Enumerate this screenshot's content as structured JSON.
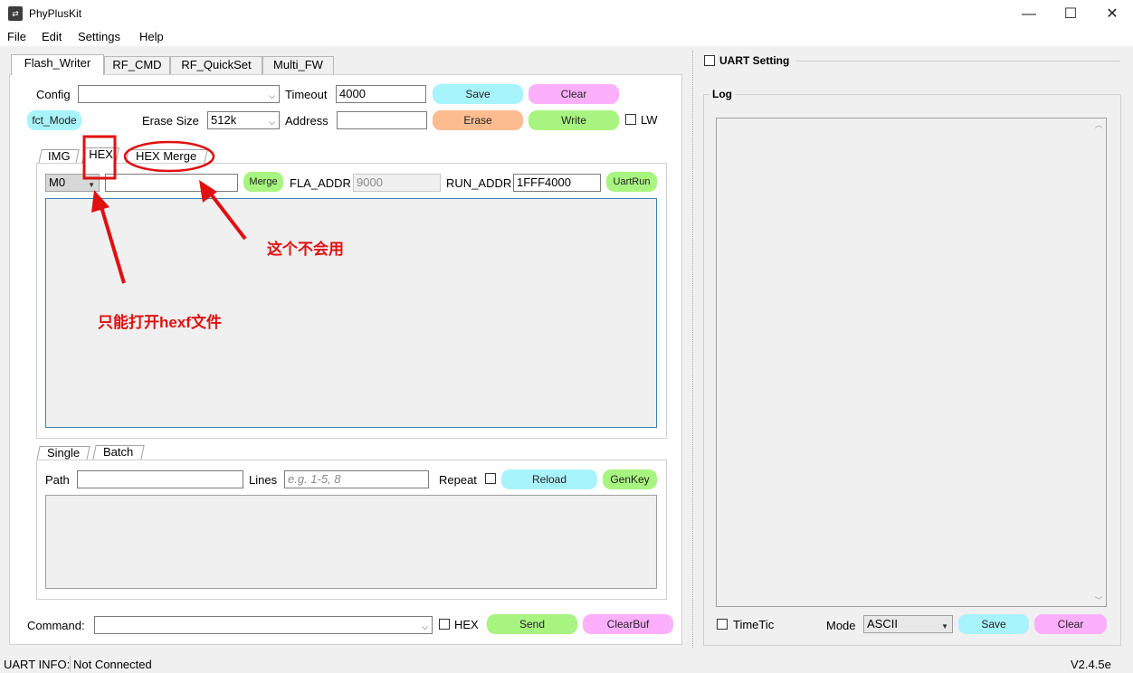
{
  "window": {
    "title": "PhyPlusKit",
    "minimize": "—",
    "maximize": "☐",
    "close": "✕"
  },
  "menu": [
    "File",
    "Edit",
    "Settings",
    "Help"
  ],
  "tabs": [
    "Flash_Writer",
    "RF_CMD",
    "RF_QuickSet",
    "Multi_FW"
  ],
  "flash": {
    "config_label": "Config",
    "config_value": "",
    "timeout_label": "Timeout",
    "timeout_value": "4000",
    "save_label": "Save",
    "clear_label": "Clear",
    "fct_mode_label": "fct_Mode",
    "erase_size_label": "Erase Size",
    "erase_size_value": "512k",
    "address_label": "Address",
    "address_value": "",
    "erase_label": "Erase",
    "write_label": "Write",
    "lw_label": "LW"
  },
  "subtabs": [
    "IMG",
    "HEX",
    "HEX Merge"
  ],
  "hex": {
    "core_value": "M0",
    "file_value": "",
    "merge_label": "Merge",
    "fla_addr_label": "FLA_ADDR",
    "fla_addr_value": "9000",
    "run_addr_label": "RUN_ADDR",
    "run_addr_value": "1FFF4000",
    "uartrun_label": "UartRun"
  },
  "annotations": {
    "merge_note": "这个不会用",
    "hex_note": "只能打开hexf文件"
  },
  "batch_tabs": [
    "Single",
    "Batch"
  ],
  "batch": {
    "path_label": "Path",
    "path_value": "",
    "lines_label": "Lines",
    "lines_placeholder": "e.g. 1-5, 8",
    "repeat_label": "Repeat",
    "reload_label": "Reload",
    "genkey_label": "GenKey"
  },
  "command": {
    "label": "Command:",
    "value": "",
    "hex_label": "HEX",
    "send_label": "Send",
    "clearbuf_label": "ClearBuf"
  },
  "uart": {
    "setting_label": "UART Setting",
    "log_label": "Log",
    "timetic_label": "TimeTic",
    "mode_label": "Mode",
    "mode_value": "ASCII",
    "save_label": "Save",
    "clear_label": "Clear"
  },
  "status": {
    "label": "UART INFO:",
    "value": "Not Connected",
    "version": "V2.4.5e"
  },
  "colors": {
    "cyan_button": "#a8f4fc",
    "pink_button": "#fcb0fc",
    "orange_button": "#fcbc90",
    "green_button": "#a8f480",
    "annotation_red": "#e01010"
  }
}
